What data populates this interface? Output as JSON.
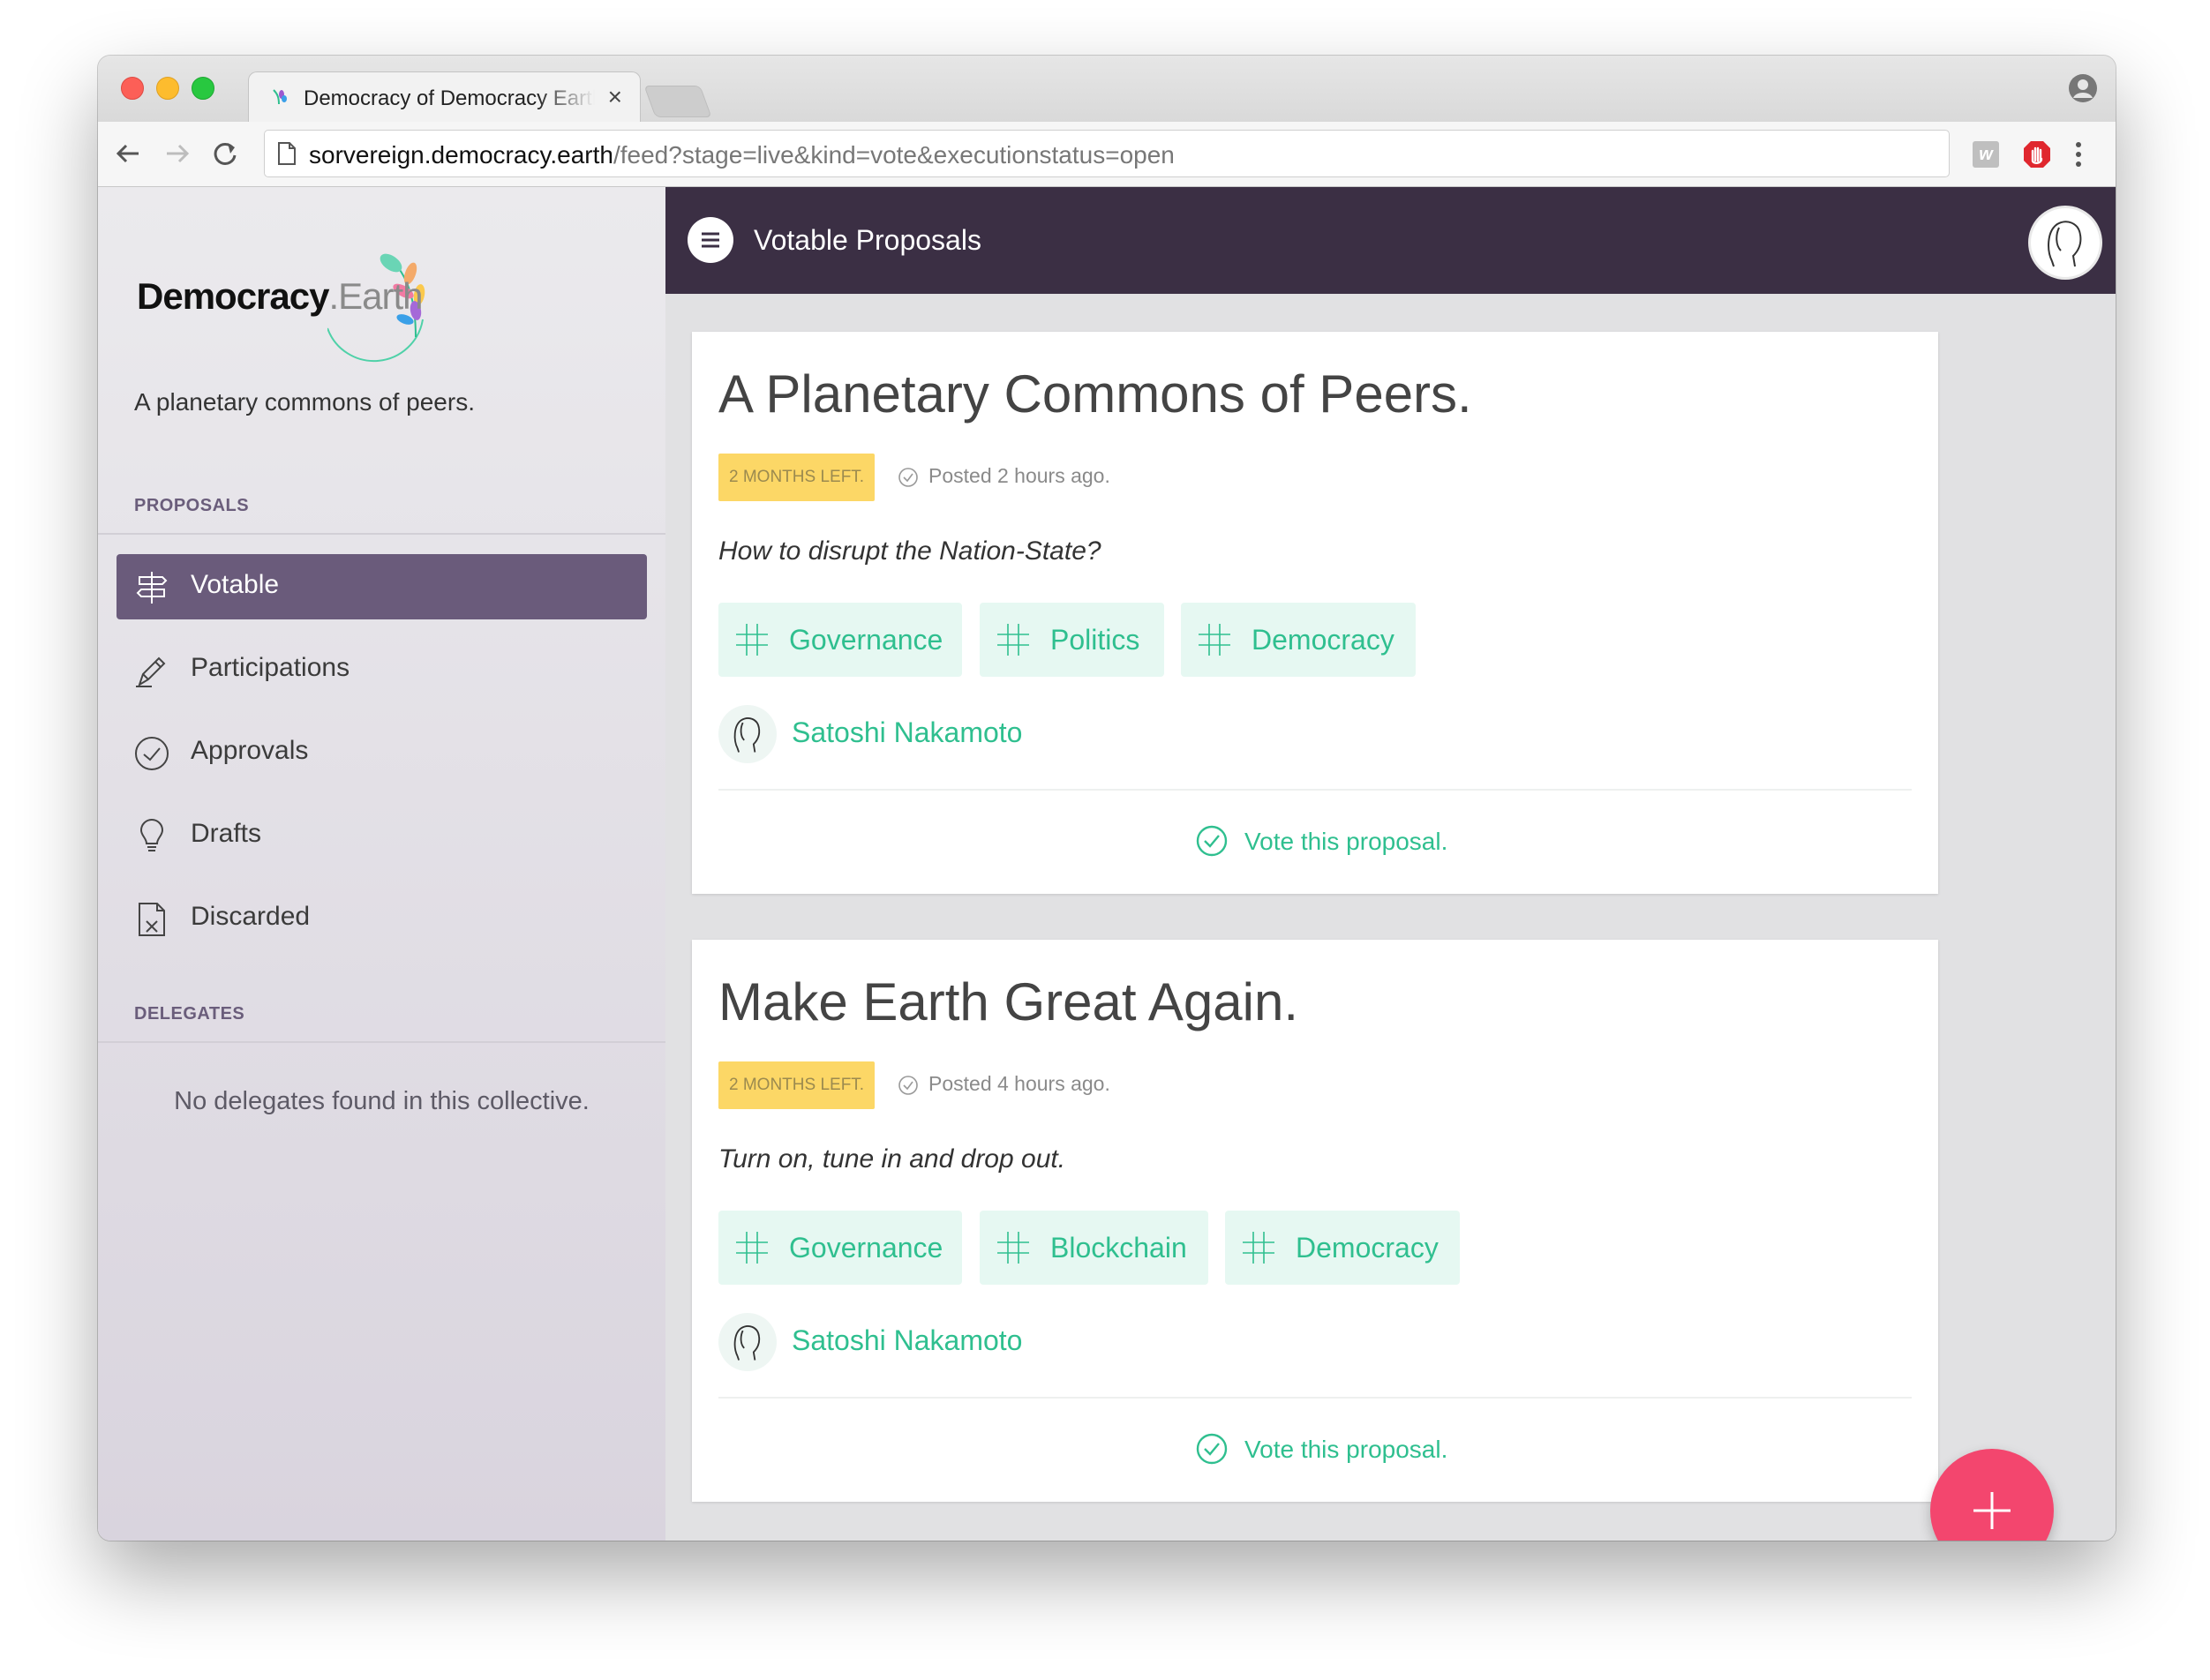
{
  "browser": {
    "tab_title": "Democracy of Democracy Earth",
    "tab_close": "×",
    "url_domain": "sorvereign.democracy.earth",
    "url_path": "/feed?stage=live&kind=vote&executionstatus=open",
    "extension_w": "w"
  },
  "sidebar": {
    "logo_bold": "Democracy",
    "logo_light": ".Earth",
    "tagline": "A planetary commons of peers.",
    "proposals_label": "PROPOSALS",
    "items": [
      {
        "label": "Votable",
        "icon": "signpost-icon",
        "active": true
      },
      {
        "label": "Participations",
        "icon": "pen-icon",
        "active": false
      },
      {
        "label": "Approvals",
        "icon": "check-circle-icon",
        "active": false
      },
      {
        "label": "Drafts",
        "icon": "lightbulb-icon",
        "active": false
      },
      {
        "label": "Discarded",
        "icon": "discarded-document-icon",
        "active": false
      }
    ],
    "delegates_label": "DELEGATES",
    "no_delegates": "No delegates found in this collective."
  },
  "topbar": {
    "title": "Votable Proposals"
  },
  "proposals": [
    {
      "title": "A Planetary Commons of Peers.",
      "badge": "2 MONTHS LEFT.",
      "posted": "Posted 2 hours ago.",
      "description": "How to disrupt the Nation-State?",
      "tags": [
        "Governance",
        "Politics",
        "Democracy"
      ],
      "author": "Satoshi Nakamoto",
      "vote_label": "Vote this proposal."
    },
    {
      "title": "Make Earth Great Again.",
      "badge": "2 MONTHS LEFT.",
      "posted": "Posted 4 hours ago.",
      "description": "Turn on, tune in and drop out.",
      "tags": [
        "Governance",
        "Blockchain",
        "Democracy"
      ],
      "author": "Satoshi Nakamoto",
      "vote_label": "Vote this proposal."
    }
  ],
  "colors": {
    "accent_green": "#2fbf8f",
    "sidebar_active": "#6a5b7b",
    "topbar": "#3b2f44",
    "badge": "#fcd766",
    "fab": "#f3466e"
  }
}
